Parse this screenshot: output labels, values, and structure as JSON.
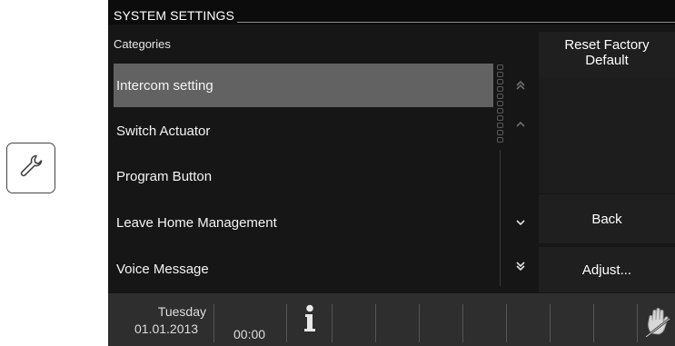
{
  "header": {
    "title": "SYSTEM SETTINGS"
  },
  "list": {
    "heading": "Categories",
    "items": [
      {
        "label": "Intercom setting",
        "selected": true
      },
      {
        "label": "Switch Actuator"
      },
      {
        "label": "Program Button"
      },
      {
        "label": "Leave Home Management"
      },
      {
        "label": "Voice Message"
      }
    ]
  },
  "buttons": {
    "reset_line1": "Reset Factory",
    "reset_line2": "Default",
    "back": "Back",
    "adjust": "Adjust..."
  },
  "status": {
    "day": "Tuesday",
    "date": "01.01.2013",
    "time": "00:00"
  },
  "icons": {
    "tool": "wrench-icon",
    "info": "info-icon",
    "hand": "hand-icon",
    "page_up": "double-chevron-up-icon",
    "line_up": "chevron-up-icon",
    "line_down": "chevron-down-icon",
    "page_down": "double-chevron-down-icon"
  },
  "colors": {
    "screen_bg": "#161616",
    "selected_row": "#626262",
    "panel_bg": "#1f1f1f",
    "statusbar_bg": "#2e2e2e"
  }
}
